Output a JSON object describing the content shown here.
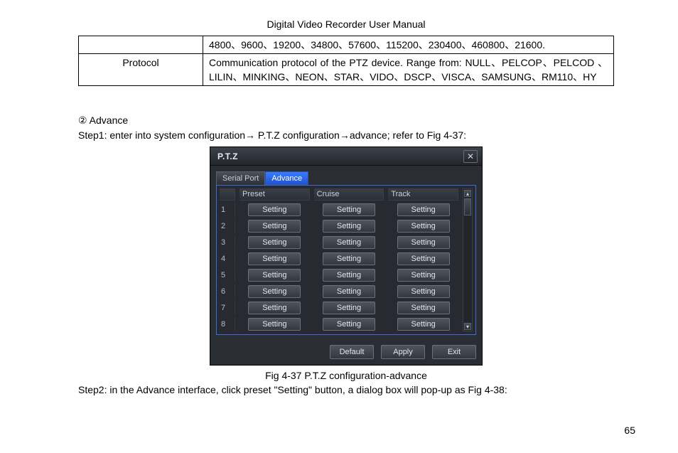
{
  "document": {
    "title": "Digital Video Recorder User Manual",
    "page_number": "65"
  },
  "spec_table": {
    "row1_value": "4800、9600、19200、34800、57600、115200、230400、460800、21600.",
    "row2_label": "Protocol",
    "row2_value": "Communication protocol of the PTZ device. Range from: NULL、PELCOP、PELCOD 、LILIN、MINKING、NEON、STAR、VIDO、DSCP、VISCA、SAMSUNG、RM110、HY"
  },
  "section": {
    "heading": "②  Advance",
    "step1": "Step1: enter into system configuration→ P.T.Z configuration→advance; refer to Fig 4-37:",
    "caption": "Fig 4-37 P.T.Z configuration-advance",
    "step2": "Step2: in the Advance interface, click preset \"Setting\" button, a dialog box will pop-up as Fig 4-38:"
  },
  "ptz": {
    "title": "P.T.Z",
    "close_glyph": "✕",
    "tabs": {
      "serial": "Serial Port",
      "advance": "Advance"
    },
    "columns": {
      "preset": "Preset",
      "cruise": "Cruise",
      "track": "Track"
    },
    "rows": [
      {
        "num": "1",
        "preset": "Setting",
        "cruise": "Setting",
        "track": "Setting"
      },
      {
        "num": "2",
        "preset": "Setting",
        "cruise": "Setting",
        "track": "Setting"
      },
      {
        "num": "3",
        "preset": "Setting",
        "cruise": "Setting",
        "track": "Setting"
      },
      {
        "num": "4",
        "preset": "Setting",
        "cruise": "Setting",
        "track": "Setting"
      },
      {
        "num": "5",
        "preset": "Setting",
        "cruise": "Setting",
        "track": "Setting"
      },
      {
        "num": "6",
        "preset": "Setting",
        "cruise": "Setting",
        "track": "Setting"
      },
      {
        "num": "7",
        "preset": "Setting",
        "cruise": "Setting",
        "track": "Setting"
      },
      {
        "num": "8",
        "preset": "Setting",
        "cruise": "Setting",
        "track": "Setting"
      }
    ],
    "scroll": {
      "up": "▴",
      "down": "▾"
    },
    "footer": {
      "default": "Default",
      "apply": "Apply",
      "exit": "Exit"
    }
  }
}
